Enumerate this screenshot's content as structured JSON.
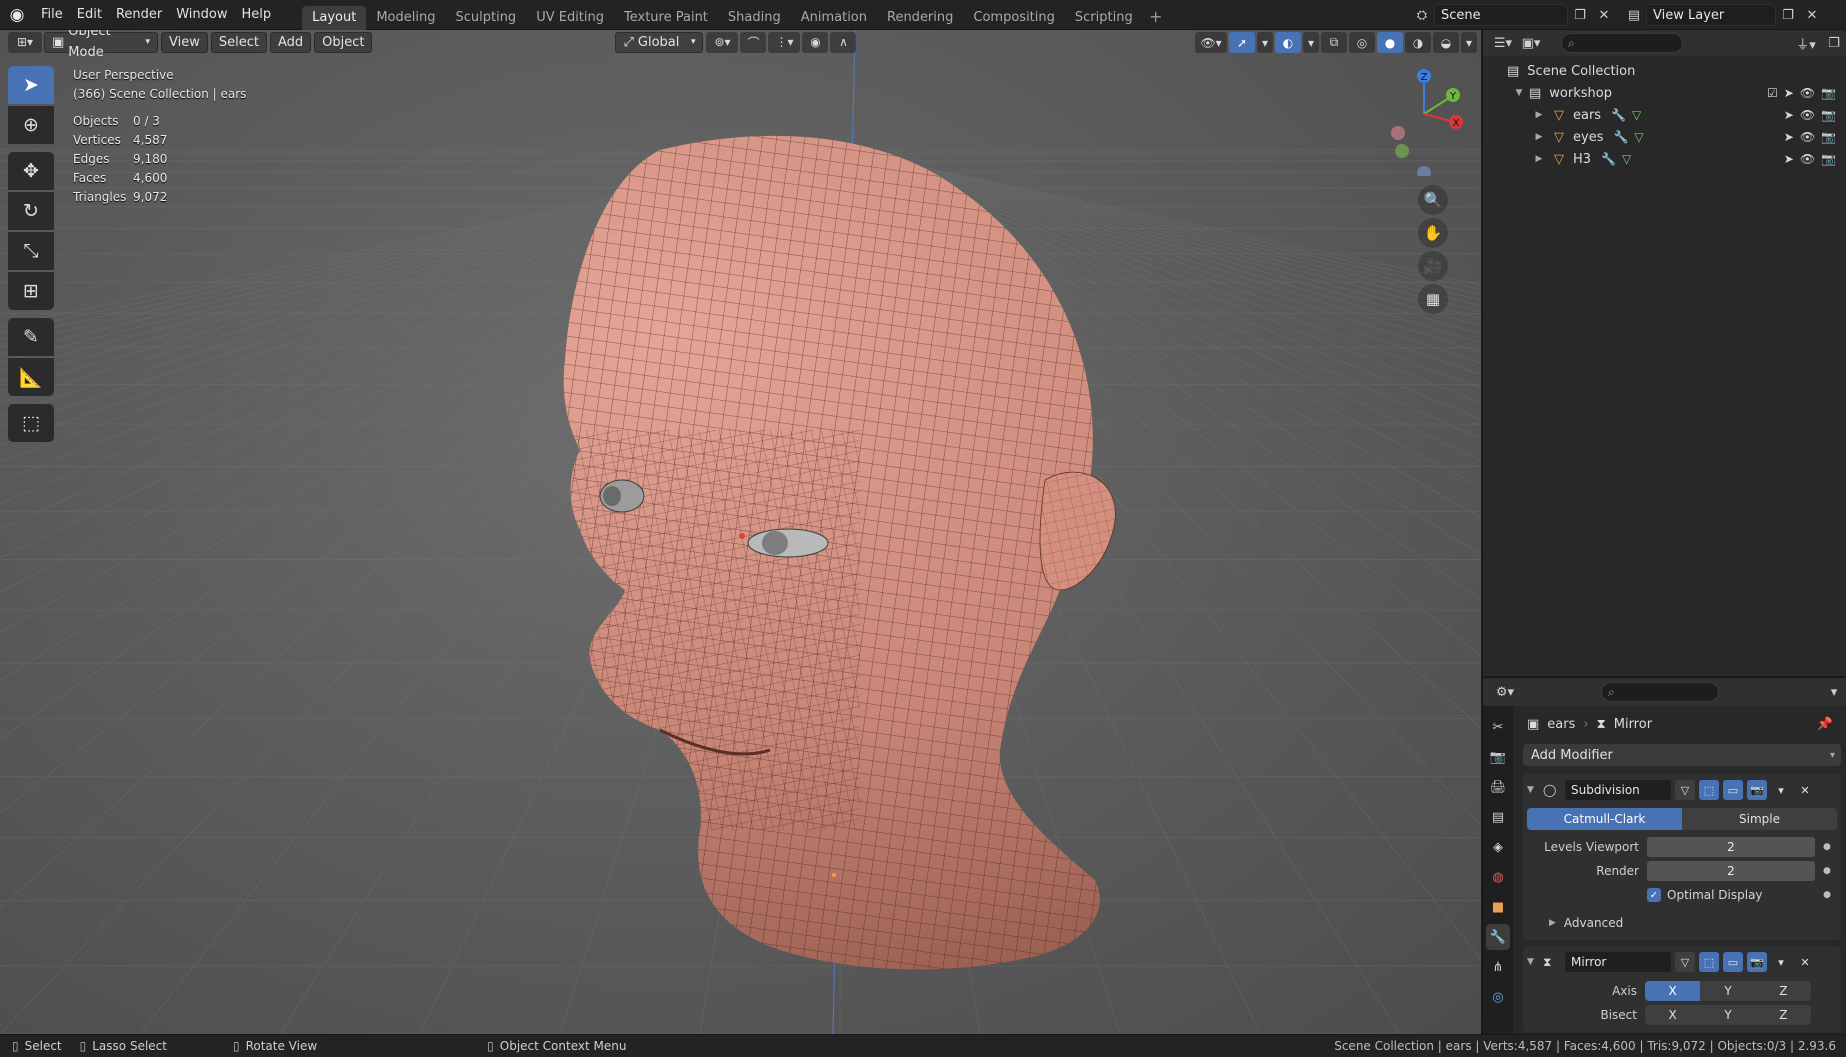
{
  "menu": {
    "items": [
      "File",
      "Edit",
      "Render",
      "Window",
      "Help"
    ]
  },
  "workspaces": {
    "tabs": [
      "Layout",
      "Modeling",
      "Sculpting",
      "UV Editing",
      "Texture Paint",
      "Shading",
      "Animation",
      "Rendering",
      "Compositing",
      "Scripting"
    ],
    "active": "Layout",
    "add_label": "+"
  },
  "scene": {
    "name": "Scene",
    "view_layer": "View Layer"
  },
  "viewport": {
    "mode": "Object Mode",
    "menus": [
      "View",
      "Select",
      "Add",
      "Object"
    ],
    "orientation": "Global",
    "perspective": "User Perspective",
    "collection_line": "(366) Scene Collection | ears",
    "stats": [
      {
        "label": "Objects",
        "value": "0 / 3"
      },
      {
        "label": "Vertices",
        "value": "4,587"
      },
      {
        "label": "Edges",
        "value": "9,180"
      },
      {
        "label": "Faces",
        "value": "4,600"
      },
      {
        "label": "Triangles",
        "value": "9,072"
      }
    ],
    "gizmo": {
      "x": "X",
      "y": "Y",
      "z": "Z"
    },
    "mesh_color": "#c98676",
    "wire_color": "#3a1f1a"
  },
  "outliner": {
    "root": "Scene Collection",
    "collection": "workshop",
    "objects": [
      "ears",
      "eyes",
      "H3"
    ]
  },
  "properties": {
    "object": "ears",
    "modifier_crumb": "Mirror",
    "add_modifier": "Add Modifier",
    "subdivision": {
      "name": "Subdivision",
      "modes": [
        "Catmull-Clark",
        "Simple"
      ],
      "levels_viewport_label": "Levels Viewport",
      "levels_viewport": "2",
      "render_label": "Render",
      "render": "2",
      "optimal_display": "Optimal Display",
      "advanced": "Advanced"
    },
    "mirror": {
      "name": "Mirror",
      "axis_label": "Axis",
      "bisect_label": "Bisect",
      "axes": [
        "X",
        "Y",
        "Z"
      ]
    }
  },
  "status": {
    "select": "Select",
    "lasso": "Lasso Select",
    "rotate": "Rotate View",
    "context": "Object Context Menu",
    "right": "Scene Collection | ears | Verts:4,587 | Faces:4,600 | Tris:9,072 | Objects:0/3 | 2.93.6"
  },
  "colors": {
    "accent": "#4772b3",
    "axis_x": "#d8383d",
    "axis_y": "#6bb83a",
    "axis_z": "#3b7de0"
  }
}
